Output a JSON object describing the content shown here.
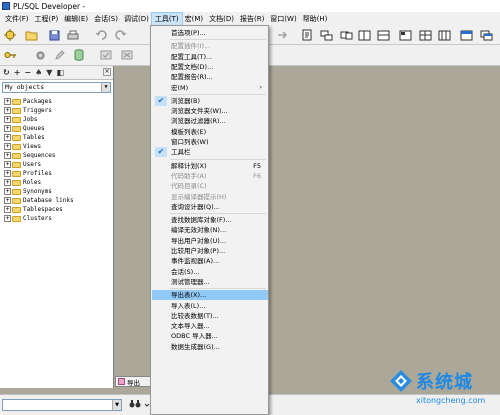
{
  "window": {
    "title": "PL/SQL Developer -"
  },
  "menubar": [
    "文件(F)",
    "工程(P)",
    "编辑(E)",
    "会话(S)",
    "调试(D)",
    "工具(T)",
    "宏(M)",
    "文档(D)",
    "报告(R)",
    "窗口(W)",
    "帮助(H)"
  ],
  "active_menu_index": 5,
  "tools_menu": {
    "items": [
      {
        "label": "首选项(P)...",
        "state": "normal"
      },
      {
        "sep": true
      },
      {
        "label": "配置插件(I)...",
        "state": "disabled"
      },
      {
        "label": "配置工具(T)...",
        "state": "normal"
      },
      {
        "label": "配置文档(D)...",
        "state": "normal"
      },
      {
        "label": "配置报告(R)...",
        "state": "normal"
      },
      {
        "label": "宏(M)",
        "state": "normal",
        "submenu": true
      },
      {
        "sep": true
      },
      {
        "label": "浏览器(B)",
        "state": "checked"
      },
      {
        "label": "浏览器文件夹(W)...",
        "state": "normal"
      },
      {
        "label": "浏览器过滤器(R)...",
        "state": "normal"
      },
      {
        "label": "模板列表(E)",
        "state": "normal"
      },
      {
        "label": "窗口列表(W)",
        "state": "normal"
      },
      {
        "label": "工具栏",
        "state": "checked"
      },
      {
        "sep": true
      },
      {
        "label": "解释计划(X)",
        "state": "normal",
        "shortcut": "F5"
      },
      {
        "label": "代码助手(A)",
        "state": "disabled",
        "shortcut": "F6"
      },
      {
        "label": "代码目录(C)",
        "state": "disabled"
      },
      {
        "label": "显示编译器提示(H)",
        "state": "disabled"
      },
      {
        "label": "查询设计器(Q)...",
        "state": "normal"
      },
      {
        "sep": true
      },
      {
        "label": "查找数据库对象(F)...",
        "state": "normal"
      },
      {
        "label": "编译无效对象(N)...",
        "state": "normal"
      },
      {
        "label": "导出用户对象(U)...",
        "state": "normal"
      },
      {
        "label": "比较用户对象(P)...",
        "state": "normal"
      },
      {
        "label": "事件监视器(A)...",
        "state": "normal"
      },
      {
        "label": "会话(S)...",
        "state": "normal"
      },
      {
        "label": "测试管理器...",
        "state": "normal"
      },
      {
        "sep": true
      },
      {
        "label": "导出表(X)...",
        "state": "highlighted"
      },
      {
        "label": "导入表(L)...",
        "state": "normal"
      },
      {
        "label": "比较表数据(T)...",
        "state": "normal"
      },
      {
        "label": "文本导入器...",
        "state": "normal"
      },
      {
        "label": "ODBC 导入器...",
        "state": "normal"
      },
      {
        "label": "数据生成器(G)...",
        "state": "normal"
      }
    ]
  },
  "object_browser": {
    "selector_value": "My objects",
    "folders": [
      "Packages",
      "Triggers",
      "Jobs",
      "Queues",
      "Tables",
      "Views",
      "Sequences",
      "Users",
      "Profiles",
      "Roles",
      "Synonyms",
      "Database links",
      "Tablespaces",
      "Clusters"
    ]
  },
  "window_list": {
    "label": "导出"
  },
  "watermark": {
    "title": "系统城",
    "url": "xitongcheng.com"
  },
  "colors": {
    "highlight": "#91c9f7",
    "check_bg": "#c5e1f7",
    "watermark": "#1e88e5",
    "workspace": "#aca899"
  }
}
